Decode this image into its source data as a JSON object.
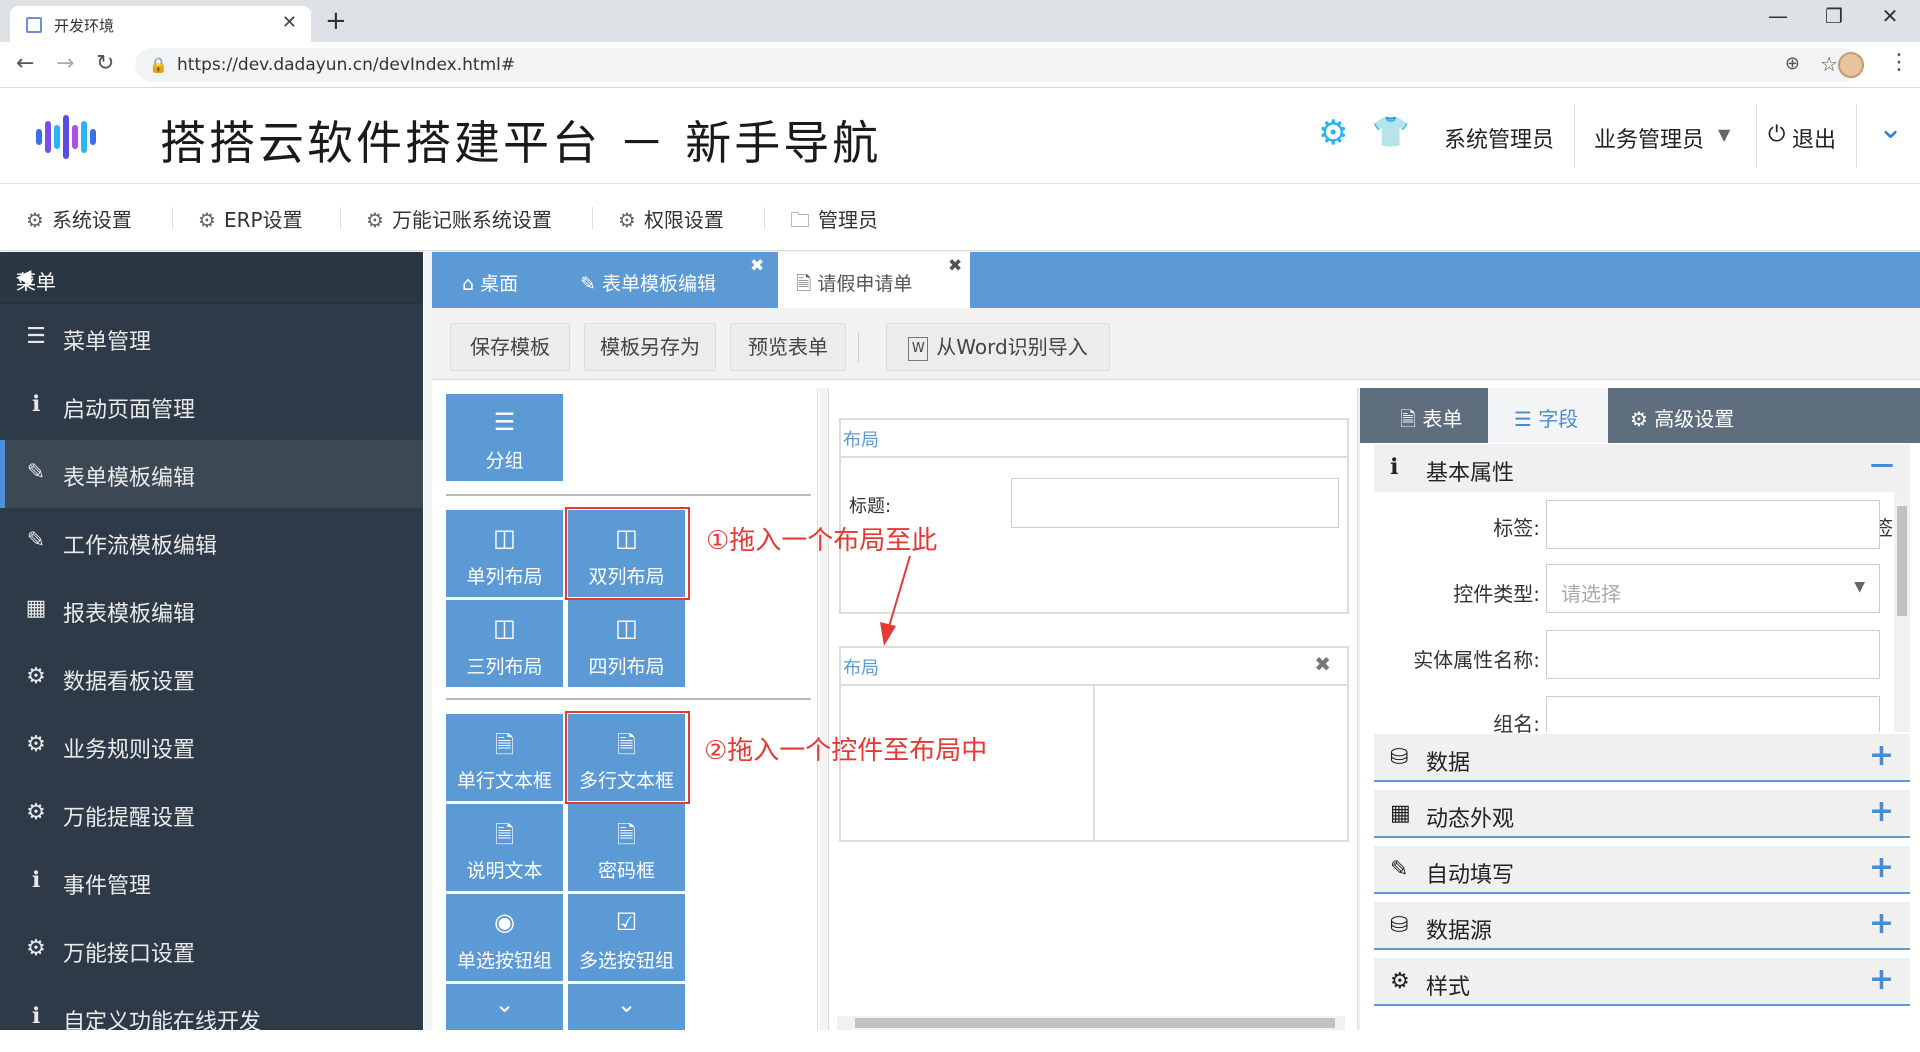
{
  "browser": {
    "tab_title": "开发环境",
    "tab_close": "✕",
    "new_tab": "+",
    "url": "https://dev.dadayun.cn/devIndex.html#",
    "win_min": "—",
    "win_max": "❐",
    "win_close": "✕"
  },
  "header": {
    "title": "搭搭云软件搭建平台 － 新手导航",
    "gear_glyph": "⚙",
    "shirt_glyph": "👕",
    "sys_admin": "系统管理员",
    "biz_admin": "业务管理员",
    "logout": "退出",
    "power_glyph": "⏻",
    "expand_glyph": "⌄"
  },
  "topmenu": {
    "items": [
      {
        "label": "系统设置",
        "icon": "⚙"
      },
      {
        "label": "ERP设置",
        "icon": "⚙"
      },
      {
        "label": "万能记账系统设置",
        "icon": "⚙"
      },
      {
        "label": "权限设置",
        "icon": "⚙"
      },
      {
        "label": "管理员",
        "icon": "🗀"
      }
    ]
  },
  "sidebar": {
    "title": "菜单",
    "collapse_glyph": "◀",
    "items": [
      {
        "label": "菜单管理",
        "icon": "☰"
      },
      {
        "label": "启动页面管理",
        "icon": "ℹ"
      },
      {
        "label": "表单模板编辑",
        "icon": "✎"
      },
      {
        "label": "工作流模板编辑",
        "icon": "✎"
      },
      {
        "label": "报表模板编辑",
        "icon": "▦"
      },
      {
        "label": "数据看板设置",
        "icon": "⚙"
      },
      {
        "label": "业务规则设置",
        "icon": "⚙"
      },
      {
        "label": "万能提醒设置",
        "icon": "⚙"
      },
      {
        "label": "事件管理",
        "icon": "ℹ"
      },
      {
        "label": "万能接口设置",
        "icon": "⚙"
      },
      {
        "label": "自定义功能在线开发",
        "icon": "ℹ"
      }
    ],
    "active_index": 2
  },
  "content_tabs": {
    "items": [
      {
        "label": "桌面",
        "icon": "⌂"
      },
      {
        "label": "表单模板编辑",
        "icon": "✎"
      },
      {
        "label": "请假申请单",
        "icon": "🗎"
      }
    ],
    "close_glyph": "✖"
  },
  "toolbar": {
    "save": "保存模板",
    "save_as": "模板另存为",
    "preview": "预览表单",
    "import_word": "从Word识别导入",
    "word_glyph": "W"
  },
  "palette": {
    "group": {
      "label": "分组",
      "icon": "☰"
    },
    "layouts": [
      {
        "label": "单列布局",
        "icon": "◫"
      },
      {
        "label": "双列布局",
        "icon": "◫"
      },
      {
        "label": "三列布局",
        "icon": "◫"
      },
      {
        "label": "四列布局",
        "icon": "◫"
      }
    ],
    "controls": [
      {
        "label": "单行文本框",
        "icon": "🗎"
      },
      {
        "label": "多行文本框",
        "icon": "🗎"
      },
      {
        "label": "说明文本",
        "icon": "🗎"
      },
      {
        "label": "密码框",
        "icon": "🗎"
      },
      {
        "label": "单选按钮组",
        "icon": "◉"
      },
      {
        "label": "多选按钮组",
        "icon": "☑"
      }
    ],
    "more_glyph": "⌄"
  },
  "canvas": {
    "layout1_title": "布局",
    "title_label": "标题:",
    "layout2_title": "布局",
    "close_glyph": "✖",
    "annotation1": "①拖入一个布局至此",
    "annotation2": "②拖入一个控件至布局中"
  },
  "properties": {
    "tabs": [
      {
        "label": "表单",
        "icon": "🗎"
      },
      {
        "label": "字段",
        "icon": "☰"
      },
      {
        "label": "高级设置",
        "icon": "⚙"
      }
    ],
    "basic": {
      "label": "基本属性",
      "icon": "ℹ",
      "toggle": "—"
    },
    "fields": {
      "tag_label": "标签:",
      "control_type_label": "控件类型:",
      "control_type_placeholder": "请选择",
      "entity_label": "实体属性名称:",
      "group_label": "组名:"
    },
    "sections": [
      {
        "label": "数据",
        "icon": "⛁"
      },
      {
        "label": "动态外观",
        "icon": "▦"
      },
      {
        "label": "自动填写",
        "icon": "✎"
      },
      {
        "label": "数据源",
        "icon": "⛁"
      },
      {
        "label": "样式",
        "icon": "⚙"
      }
    ],
    "plus_glyph": "+"
  },
  "colors": {
    "accent": "#5b9ad5",
    "sidebar_bg": "#2e3a47",
    "annotation_red": "#e53935",
    "header_icon": "#2bb5f0"
  }
}
